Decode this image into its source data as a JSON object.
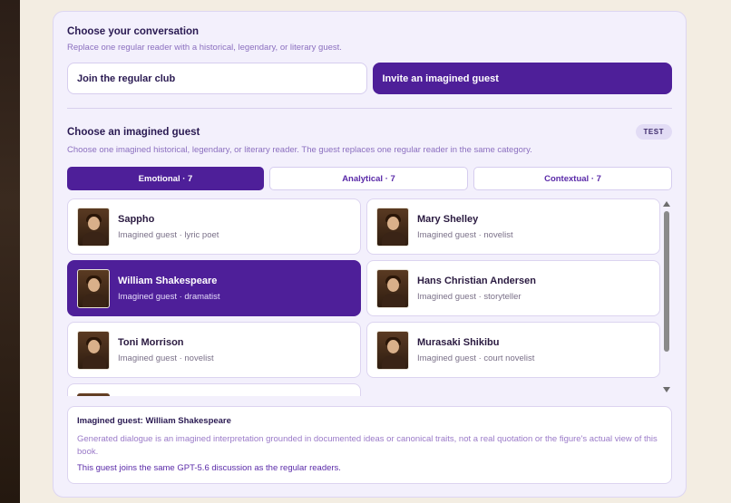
{
  "conversation": {
    "title": "Choose your conversation",
    "subtitle": "Replace one regular reader with a historical, legendary, or literary guest.",
    "options": [
      {
        "label": "Join the regular club",
        "selected": false
      },
      {
        "label": "Invite an imagined guest",
        "selected": true
      }
    ]
  },
  "guest_picker": {
    "title": "Choose an imagined guest",
    "badge": "TEST",
    "subtitle": "Choose one imagined historical, legendary, or literary reader. The guest replaces one regular reader in the same category.",
    "tabs": [
      {
        "label": "Emotional · 7",
        "selected": true
      },
      {
        "label": "Analytical · 7",
        "selected": false
      },
      {
        "label": "Contextual · 7",
        "selected": false
      }
    ],
    "guests": [
      {
        "name": "Sappho",
        "role": "Imagined guest · lyric poet",
        "selected": false
      },
      {
        "name": "Mary Shelley",
        "role": "Imagined guest · novelist",
        "selected": false
      },
      {
        "name": "William Shakespeare",
        "role": "Imagined guest · dramatist",
        "selected": true
      },
      {
        "name": "Hans Christian Andersen",
        "role": "Imagined guest · storyteller",
        "selected": false
      },
      {
        "name": "Toni Morrison",
        "role": "Imagined guest · novelist",
        "selected": false
      },
      {
        "name": "Murasaki Shikibu",
        "role": "Imagined guest · court novelist",
        "selected": false
      }
    ]
  },
  "info": {
    "title": "Imagined guest: William Shakespeare",
    "text": "Generated dialogue is an imagined interpretation grounded in documented ideas or canonical traits, not a real quotation or the figure's actual view of this book.",
    "note": "This guest joins the same GPT-5.6 discussion as the regular readers."
  },
  "colors": {
    "accent": "#4e1f99",
    "card_bg": "#f3f0fc",
    "page_bg": "#f3ede2"
  }
}
